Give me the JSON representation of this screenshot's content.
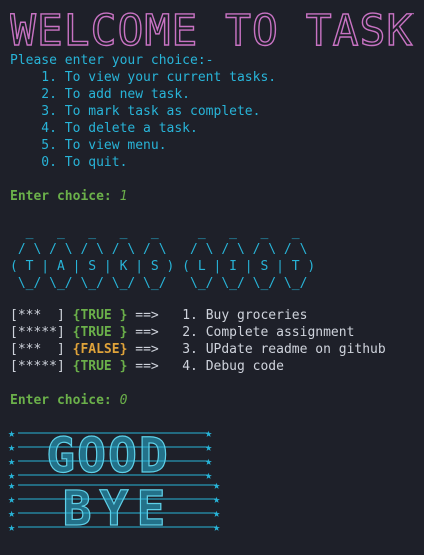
{
  "banner": {
    "title": "WELCOME TO TASKY"
  },
  "menu": {
    "heading": "Please enter your choice:-",
    "items": [
      "    1. To view your current tasks.",
      "    2. To add new task.",
      "    3. To mark task as complete.",
      "    4. To delete a task.",
      "    5. To view menu.",
      "    0. To quit."
    ]
  },
  "prompts": [
    {
      "label": "Enter choice:",
      "value": "1"
    },
    {
      "label": "Enter choice:",
      "value": "0"
    }
  ],
  "tasks_art": {
    "lines": [
      "  _   _   _   _   _     _   _   _   _",
      " / \\ / \\ / \\ / \\ / \\   / \\ / \\ / \\ / \\",
      "( T | A | S | K | S ) ( L | I | S | T )",
      " \\_/ \\_/ \\_/ \\_/ \\_/   \\_/ \\_/ \\_/ \\_/"
    ]
  },
  "tasks": [
    {
      "progress": "[***  ]",
      "status": "{TRUE }",
      "arrow": " ==>",
      "text": "   1. Buy groceries",
      "status_color": "#6bb04a"
    },
    {
      "progress": "[*****]",
      "status": "{TRUE }",
      "arrow": " ==>",
      "text": "   2. Complete assignment",
      "status_color": "#6bb04a"
    },
    {
      "progress": "[***  ]",
      "status": "{FALSE}",
      "arrow": " ==>",
      "text": "   3. UPdate readme on github",
      "status_color": "#e0a33a"
    },
    {
      "progress": "[*****]",
      "status": "{TRUE }",
      "arrow": " ==>",
      "text": "   4. Debug code",
      "status_color": "#6bb04a"
    }
  ],
  "bye_art": {
    "good_text": "GOOD",
    "bye_text": "BYE"
  },
  "colors": {
    "background": "#1e2029",
    "banner": "#c873c3",
    "menu": "#28b4d8",
    "prompt": "#6bb04a",
    "status_true": "#6bb04a",
    "status_false": "#e0a33a",
    "text": "#cfd3dc",
    "art": "#28b4d8"
  }
}
